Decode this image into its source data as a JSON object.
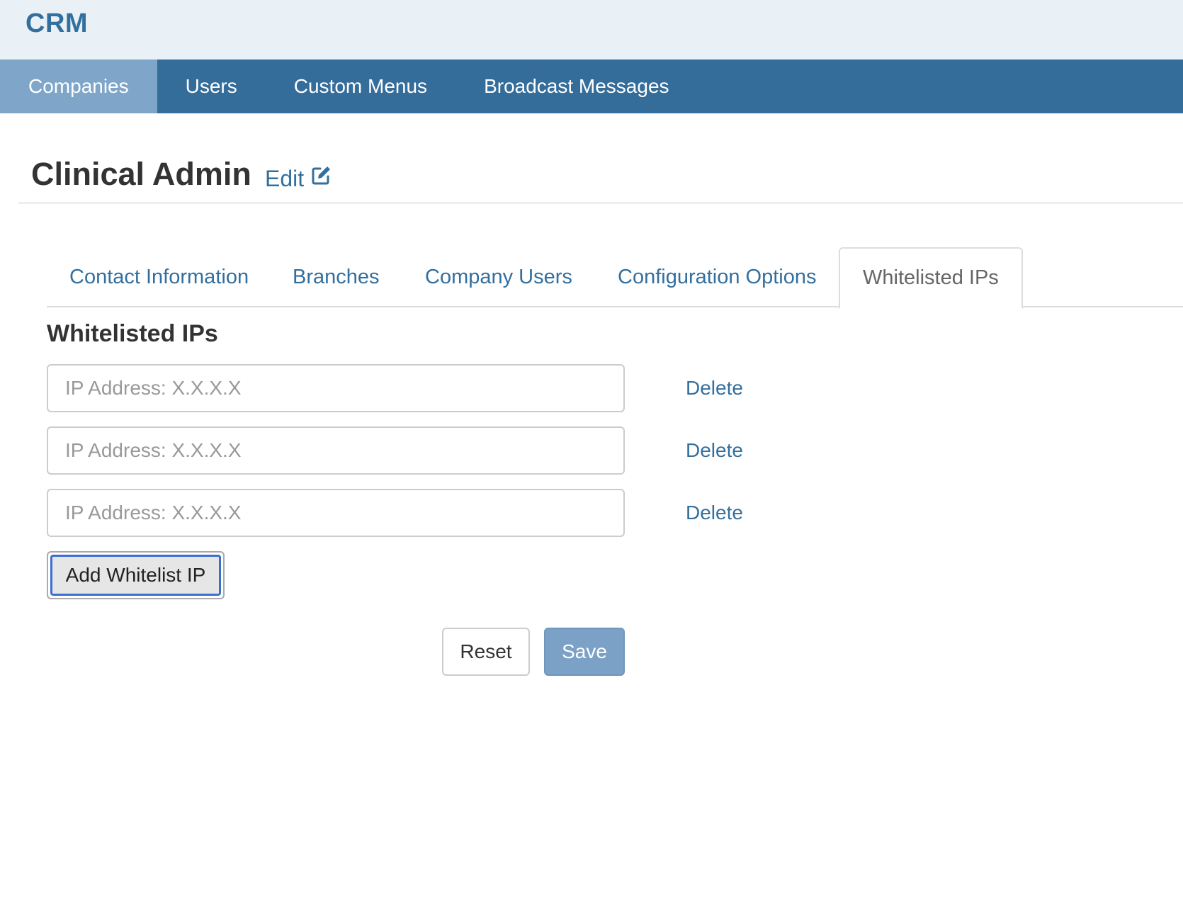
{
  "app": {
    "brand": "CRM"
  },
  "nav": {
    "items": [
      {
        "label": "Companies",
        "active": true
      },
      {
        "label": "Users",
        "active": false
      },
      {
        "label": "Custom Menus",
        "active": false
      },
      {
        "label": "Broadcast Messages",
        "active": false
      }
    ]
  },
  "page": {
    "title": "Clinical Admin",
    "edit_label": "Edit",
    "edit_icon": "pencil-square-icon"
  },
  "tabs": [
    {
      "label": "Contact Information",
      "active": false
    },
    {
      "label": "Branches",
      "active": false
    },
    {
      "label": "Company Users",
      "active": false
    },
    {
      "label": "Configuration Options",
      "active": false
    },
    {
      "label": "Whitelisted IPs",
      "active": true
    }
  ],
  "whitelist": {
    "heading": "Whitelisted IPs",
    "rows": [
      {
        "value": "",
        "placeholder": "IP Address: X.X.X.X",
        "delete_label": "Delete"
      },
      {
        "value": "",
        "placeholder": "IP Address: X.X.X.X",
        "delete_label": "Delete"
      },
      {
        "value": "",
        "placeholder": "IP Address: X.X.X.X",
        "delete_label": "Delete"
      }
    ],
    "add_label": "Add Whitelist IP"
  },
  "actions": {
    "reset_label": "Reset",
    "save_label": "Save"
  },
  "colors": {
    "brand": "#336f9e",
    "navbar": "#346c9a",
    "nav_active": "#7fa6c9",
    "link": "#336f9e",
    "save_button": "#7ba1c6",
    "focus_ring": "#3b6fd0"
  }
}
